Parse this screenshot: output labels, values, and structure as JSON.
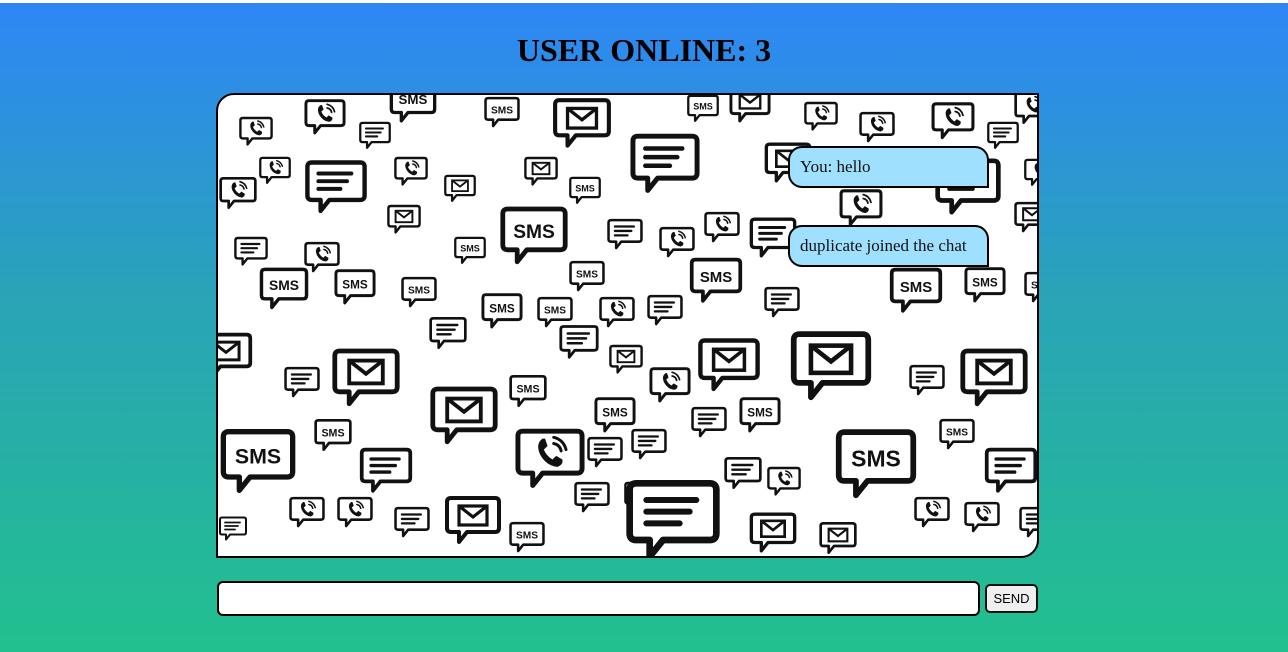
{
  "header": {
    "title": "USER ONLINE: 3"
  },
  "chat": {
    "messages": [
      "You: hello",
      "duplicate joined the chat"
    ],
    "message_bubble_color": "#9fe0ff"
  },
  "composer": {
    "input_value": "",
    "send_label": "SEND"
  },
  "background_pattern": {
    "icons": [
      "sms-bubble-icon",
      "message-lines-bubble-icon",
      "envelope-bubble-icon",
      "phone-bubble-icon"
    ],
    "sms_text": "SMS"
  },
  "colors": {
    "gradient_top": "#2e86f7",
    "gradient_bottom": "#22c08e"
  }
}
